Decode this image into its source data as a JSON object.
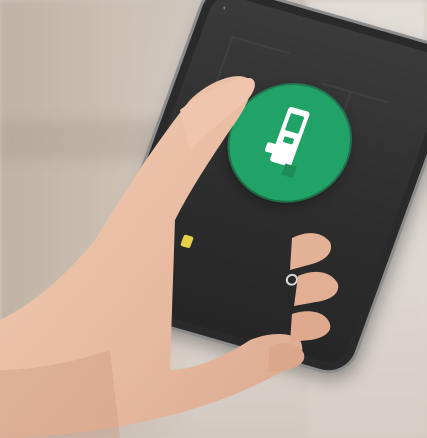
{
  "screen": {
    "status_time": "",
    "header_title": "",
    "device_name": "",
    "actions": [
      {
        "label": "",
        "icon": "lock-status-icon"
      },
      {
        "label": "",
        "icon": "settings-icon"
      }
    ],
    "lock_icon": "door-lock-icon"
  },
  "colors": {
    "accent_green": "#21a267",
    "screen_dark": "#2d2d2d",
    "skin": "#e9c0a8"
  }
}
